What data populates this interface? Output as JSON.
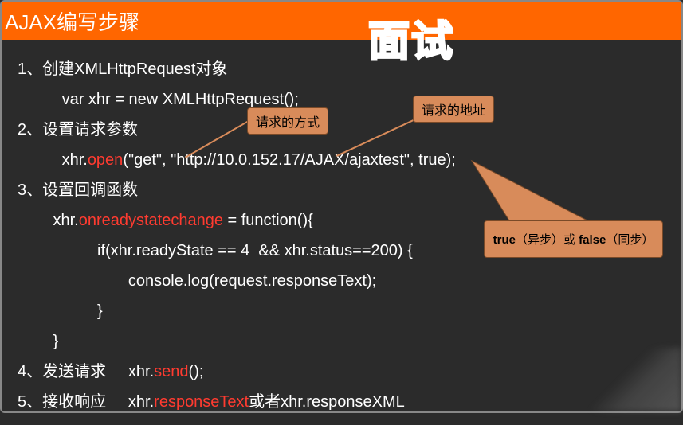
{
  "header": {
    "title": "AJAX编写步骤"
  },
  "watermark": "面试",
  "lines": {
    "l1": "1、创建XMLHttpRequest对象",
    "l2": "          var xhr = new XMLHttpRequest();",
    "l3": "2、设置请求参数",
    "l4a": "          xhr.",
    "l4b": "open",
    "l4c": "(\"get\", \"http://10.0.152.17/AJAX/ajaxtest\", true);",
    "l5": "3、设置回调函数",
    "l6a": "        xhr.",
    "l6b": "onreadystatechange",
    "l6c": " = function(){",
    "l7": "                  if(xhr.readyState == 4  && xhr.status==200) {",
    "l8": "                         console.log(request.responseText);",
    "l9": "                  }",
    "l10": "        }",
    "l11a": "4、发送请求     xhr.",
    "l11b": "send",
    "l11c": "();",
    "l12a": "5、接收响应     xhr.",
    "l12b": "responseText",
    "l12c": "或者xhr.responseXML"
  },
  "callouts": {
    "method": "请求的方式",
    "url": "请求的地址",
    "async_a": "true",
    "async_b": "（异步）或 ",
    "async_c": "false",
    "async_d": "（同步）"
  }
}
